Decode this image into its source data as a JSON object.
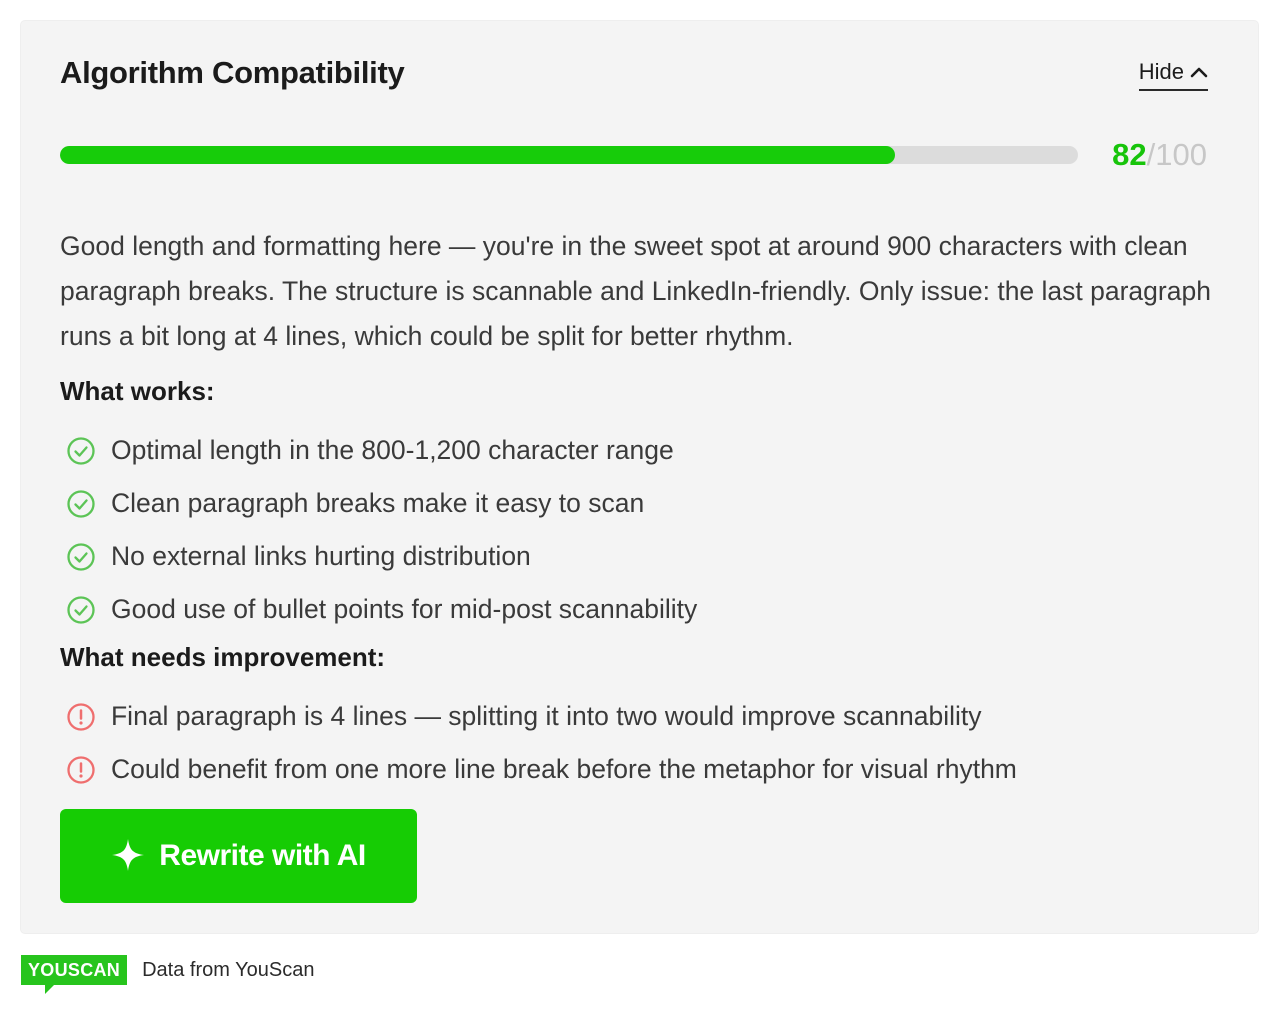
{
  "card": {
    "title": "Algorithm Compatibility",
    "hide_label": "Hide",
    "hide_icon": "chevron-up-icon"
  },
  "score": {
    "value": "82",
    "max": "/100",
    "fraction": 0.82
  },
  "summary": "Good length and formatting here — you're in the sweet spot at around 900 characters with clean paragraph breaks. The structure is scannable and LinkedIn-friendly. Only issue: the last paragraph runs a bit long at 4 lines, which could be split for better rhythm.",
  "works": {
    "heading": "What works:",
    "icon": "check-circle-icon",
    "items": [
      "Optimal length in the 800-1,200 character range",
      "Clean paragraph breaks make it easy to scan",
      "No external links hurting distribution",
      "Good use of bullet points for mid-post scannability"
    ]
  },
  "improvements": {
    "heading": "What needs improvement:",
    "icon": "alert-circle-icon",
    "items": [
      "Final paragraph is 4 lines — splitting it into two would improve scannability",
      "Could benefit from one more line break before the metaphor for visual rhythm"
    ]
  },
  "action": {
    "label": "Rewrite with AI",
    "icon": "sparkle-icon"
  },
  "footer": {
    "logo_text": "YOUSCAN",
    "text": "Data from YouScan"
  },
  "colors": {
    "accent_green": "#16cc04",
    "score_green": "#17c40a",
    "track_gray": "#dcdcdc",
    "check_green": "#5cc456",
    "alert_red": "#ef6e6e",
    "card_bg": "#f4f4f4",
    "logo_green": "#27c41d"
  }
}
